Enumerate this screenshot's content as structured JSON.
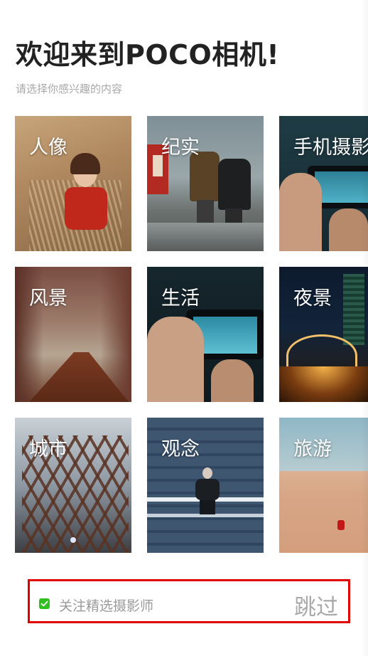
{
  "header": {
    "title": "欢迎来到POCO相机!",
    "subtitle": "请选择你感兴趣的内容"
  },
  "categories": [
    {
      "label": "人像"
    },
    {
      "label": "纪实"
    },
    {
      "label": "手机摄影"
    },
    {
      "label": "风景"
    },
    {
      "label": "生活"
    },
    {
      "label": "夜景"
    },
    {
      "label": "城市"
    },
    {
      "label": "观念"
    },
    {
      "label": "旅游"
    }
  ],
  "footer": {
    "follow_label": "关注精选摄影师",
    "follow_checked": true,
    "skip_label": "跳过"
  },
  "colors": {
    "checkbox": "#2fbf1f",
    "highlight_border": "#e00000"
  }
}
